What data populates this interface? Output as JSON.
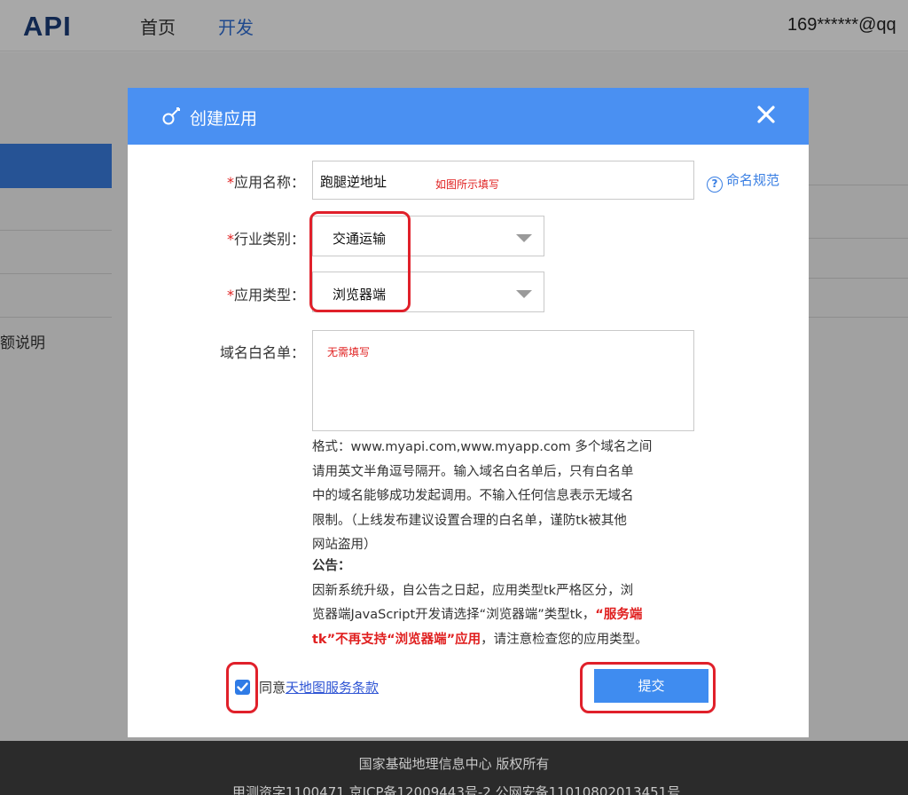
{
  "header": {
    "logo": "API",
    "nav": [
      "首页",
      "开发"
    ],
    "user_email": "169******@qq"
  },
  "background": {
    "sidebar_partial_label": "额说明"
  },
  "dialog": {
    "title": "创建应用",
    "app_name": {
      "label": "应用名称：",
      "value": "跑腿逆地址",
      "annotation": "如图所示填写"
    },
    "naming_rules_link": "命名规范",
    "industry": {
      "label": "行业类别：",
      "value": "交通运输"
    },
    "app_type": {
      "label": "应用类型：",
      "value": "浏览器端"
    },
    "whitelist": {
      "label": "域名白名单：",
      "annotation": "无需填写"
    },
    "format_note": [
      "格式：www.myapi.com,www.myapp.com 多个域名之间",
      "请用英文半角逗号隔开。输入域名白名单后，只有白名单",
      "中的域名能够成功发起调用。不输入任何信息表示无域名",
      "限制。（上线发布建议设置合理的白名单，谨防tk被其他",
      "网站盗用）"
    ],
    "notice": {
      "title": "公告：",
      "line1": "因新系统升级，自公告之日起，应用类型tk严格区分，浏",
      "line2_plain": "览器端JavaScript开发请选择“浏览器端”类型tk，",
      "line2_red": "“服务端",
      "line3_red": "tk”不再支持“浏览器端”应用",
      "line3_plain": "，请注意检查您的应用类型。"
    },
    "agree": {
      "checked": true,
      "prefix": "同意",
      "link": "天地图服务条款"
    },
    "submit_label": "提交"
  },
  "footer": {
    "line1": "国家基础地理信息中心  版权所有",
    "line2": "甲测资字1100471  京ICP备12009443号-2  公网安备11010802013451号"
  },
  "colors": {
    "header_blue": "#4a90f2",
    "link_blue": "#3a7fe3",
    "required_red": "#e02020",
    "annotation_red": "#e0202a"
  }
}
